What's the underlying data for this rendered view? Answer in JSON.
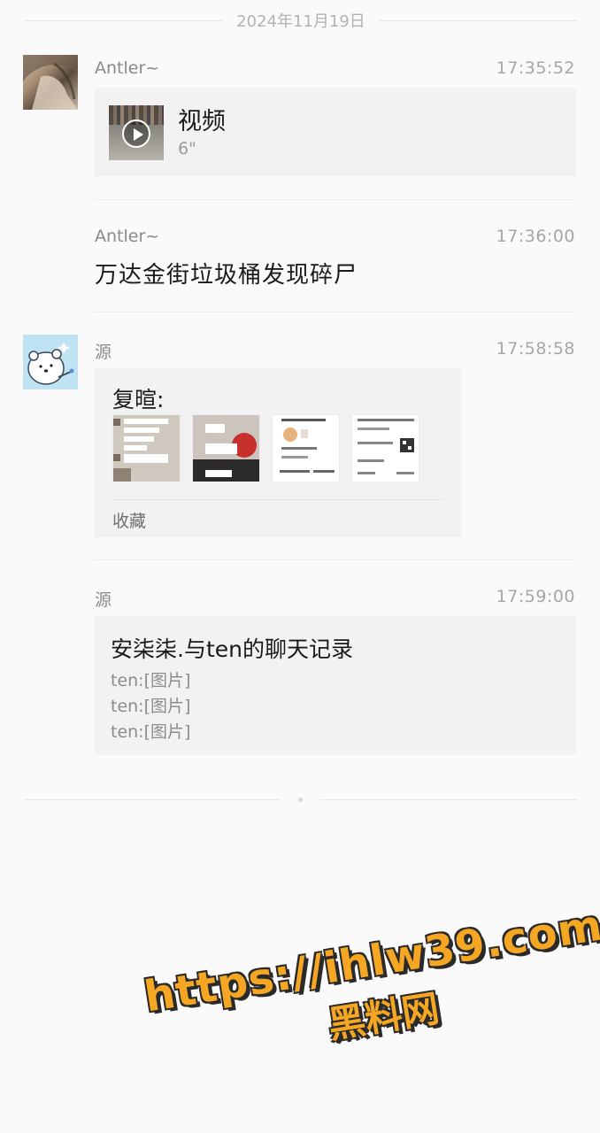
{
  "date_separator": "2024年11月19日",
  "messages": [
    {
      "sender": "Antler~",
      "time": "17:35:52",
      "type": "video",
      "video": {
        "title": "视频",
        "duration": "6\""
      }
    },
    {
      "sender": "Antler~",
      "time": "17:36:00",
      "type": "text",
      "text": "万达金街垃圾桶发现碎尸"
    },
    {
      "sender": "源",
      "time": "17:58:58",
      "type": "favorite",
      "favorite": {
        "title": "复暄:",
        "label": "收藏"
      }
    },
    {
      "sender": "源",
      "time": "17:59:00",
      "type": "chat_history",
      "chat_history": {
        "title": "安柒柒.与ten的聊天记录",
        "lines": [
          "ten:[图片]",
          "ten:[图片]",
          "ten:[图片]"
        ]
      }
    }
  ],
  "watermark": {
    "url": "https://ihlw39.com",
    "text": "黑料网"
  },
  "colors": {
    "background": "#fafafa",
    "card": "#f2f2f2",
    "watermark": "#f5a623"
  }
}
